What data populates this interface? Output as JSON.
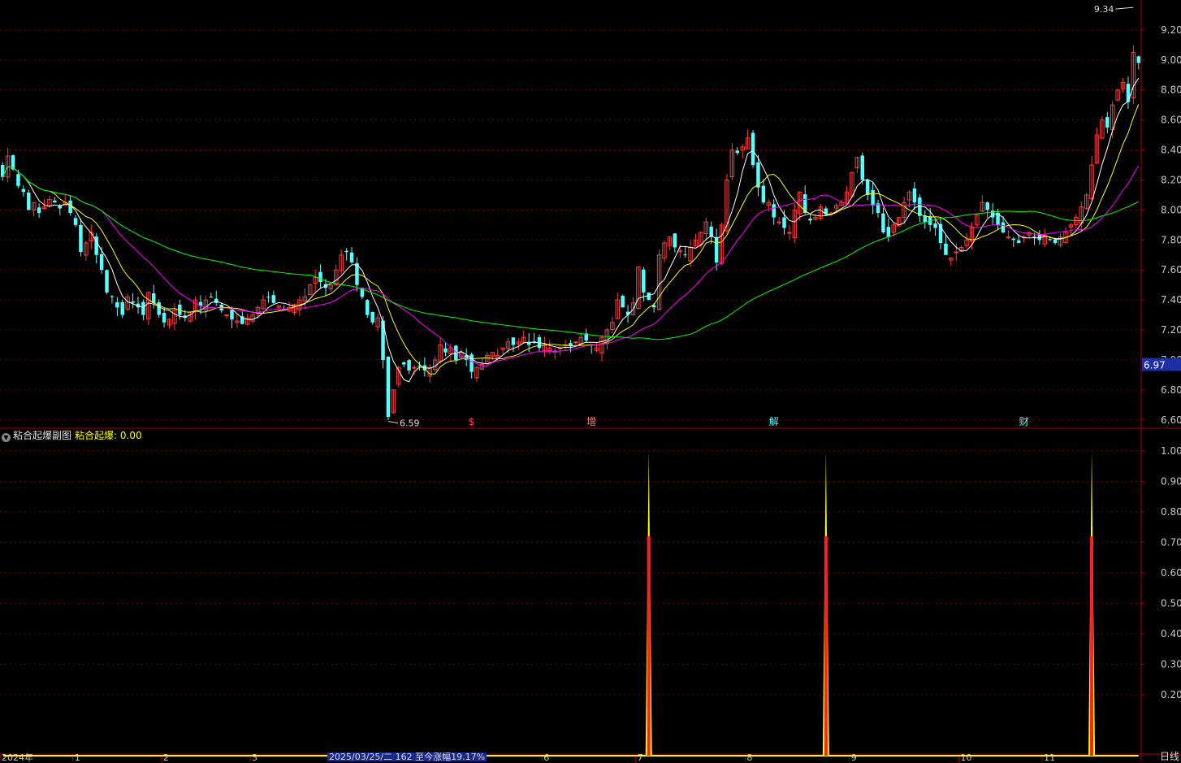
{
  "indicator": {
    "name": "粘合起爆副图",
    "label": "粘合起爆",
    "value": ": 0.00"
  },
  "status_text": "2025/03/25/二 162 至今涨幅19.17%",
  "period_label": "日线",
  "event_markers": [
    "$",
    "增",
    "解",
    "财"
  ],
  "colors": {
    "up": "#ff3b3b",
    "down": "#54ffff",
    "ma5": "#ffffff",
    "ma10": "#ffff00",
    "ma20": "#ff00ff",
    "ma60": "#00ff00",
    "axis": "#b00000",
    "signal_main": "#ffff00",
    "signal_fill": "#ff2020"
  },
  "chart_data": [
    {
      "type": "candlestick",
      "title": "",
      "ylim": [
        6.55,
        9.4
      ],
      "y_ticks": [
        "9.20",
        "9.00",
        "8.80",
        "8.60",
        "8.40",
        "8.20",
        "8.00",
        "7.80",
        "7.60",
        "7.40",
        "7.20",
        "7.00",
        "6.80",
        "6.60"
      ],
      "last_price": "6.97",
      "annotations": {
        "high": "9.34",
        "low": "6.59"
      },
      "x_labels": [
        "2024年",
        "1",
        "2",
        "3",
        "4",
        "5",
        "6",
        "7",
        "8",
        "9",
        "10",
        "11"
      ],
      "close": [
        8.22,
        8.36,
        8.27,
        8.16,
        8.12,
        8.0,
        8.05,
        7.98,
        8.02,
        8.07,
        8.05,
        8.01,
        8.05,
        7.98,
        7.9,
        7.72,
        7.78,
        7.85,
        7.7,
        7.6,
        7.45,
        7.42,
        7.35,
        7.3,
        7.42,
        7.38,
        7.35,
        7.3,
        7.45,
        7.38,
        7.3,
        7.25,
        7.27,
        7.33,
        7.3,
        7.28,
        7.32,
        7.4,
        7.36,
        7.4,
        7.42,
        7.38,
        7.33,
        7.3,
        7.27,
        7.26,
        7.24,
        7.28,
        7.3,
        7.35,
        7.4,
        7.42,
        7.38,
        7.36,
        7.33,
        7.35,
        7.37,
        7.4,
        7.42,
        7.5,
        7.55,
        7.52,
        7.48,
        7.5,
        7.6,
        7.7,
        7.72,
        7.65,
        7.5,
        7.42,
        7.3,
        7.25,
        7.28,
        7.0,
        6.62,
        6.8,
        6.95,
        6.97,
        6.93,
        6.95,
        6.96,
        6.93,
        6.95,
        7.0,
        7.1,
        7.05,
        7.08,
        7.0,
        7.05,
        7.0,
        6.92,
        6.95,
        6.97,
        7.03,
        7.05,
        7.03,
        7.08,
        7.12,
        7.1,
        7.12,
        7.15,
        7.1,
        7.12,
        7.08,
        7.1,
        7.08,
        7.06,
        7.08,
        7.1,
        7.09,
        7.12,
        7.15,
        7.13,
        7.1,
        7.08,
        7.15,
        7.2,
        7.25,
        7.4,
        7.35,
        7.3,
        7.38,
        7.62,
        7.45,
        7.4,
        7.35,
        7.7,
        7.78,
        7.82,
        7.75,
        7.73,
        7.7,
        7.75,
        7.8,
        7.85,
        7.92,
        7.82,
        7.65,
        7.9,
        8.2,
        8.4,
        8.38,
        8.42,
        8.48,
        8.3,
        8.15,
        8.05,
        8.05,
        7.95,
        7.92,
        7.88,
        7.85,
        8.0,
        8.12,
        7.98,
        7.93,
        7.95,
        8.02,
        7.97,
        7.98,
        8.03,
        8.05,
        8.12,
        8.25,
        8.35,
        8.2,
        8.1,
        8.03,
        7.98,
        7.85,
        7.82,
        7.9,
        7.95,
        8.05,
        8.12,
        8.05,
        7.96,
        7.92,
        7.9,
        7.88,
        7.78,
        7.7,
        7.68,
        7.72,
        7.75,
        7.8,
        7.88,
        7.97,
        8.05,
        8.0,
        7.95,
        7.9,
        7.85,
        7.82,
        7.8,
        7.78,
        7.82,
        7.85,
        7.82,
        7.8,
        7.83,
        7.8,
        7.78,
        7.82,
        7.85,
        7.9,
        7.95,
        8.02,
        8.1,
        8.3,
        8.5,
        8.6,
        8.55,
        8.7,
        8.8,
        8.85,
        8.72,
        9.05,
        8.98
      ],
      "series": [
        {
          "name": "MA5",
          "period": 5
        },
        {
          "name": "MA10",
          "period": 10
        },
        {
          "name": "MA20",
          "period": 20
        },
        {
          "name": "MA60",
          "period": 60
        }
      ]
    },
    {
      "type": "line",
      "title": "粘合起爆副图",
      "ylim": [
        0,
        1.05
      ],
      "y_ticks": [
        "1.00",
        "0.90",
        "0.80",
        "0.70",
        "0.60",
        "0.50",
        "0.40",
        "0.30",
        "0.20"
      ],
      "series": [
        {
          "name": "粘合起爆",
          "spikes": [
            {
              "bar": 124,
              "value": 1.0
            },
            {
              "bar": 158,
              "value": 1.0
            },
            {
              "bar": 209,
              "value": 1.0
            }
          ]
        }
      ],
      "baseline_value": 0.0
    }
  ]
}
